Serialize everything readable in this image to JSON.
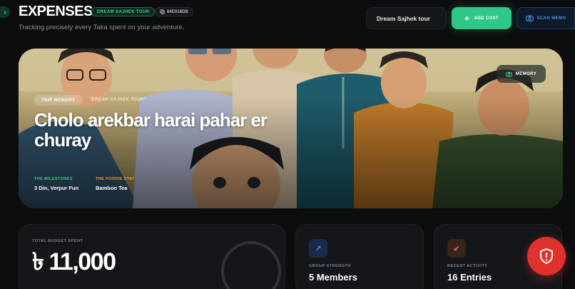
{
  "header": {
    "title": "EXPENSES",
    "trip_badge": "DREAM SAJHEK TOUR",
    "trip_id": "84D018DB",
    "subtitle": "Tracking precisely every Taka spent on your adventure."
  },
  "toolbar": {
    "trip_select_value": "Dream Sajhek tour",
    "add_cost_label": "ADD COST",
    "scan_memo_label": "SCAN MEMO"
  },
  "hero": {
    "badge": "TRIP MEMORY",
    "quote": "\"DREAM SAJHEK TOUR\"",
    "title": "Cholo arekbar harai pahar er churay",
    "memory_button": "MEMORY",
    "milestones_label": "THE MILESTONES",
    "milestones_value": "3 Din, Verpur Fun",
    "foodie_label": "THE FOODIE STAT",
    "foodie_value": "Bamboo Tea"
  },
  "cards": {
    "budget_label": "TOTAL BUDGET SPENT",
    "budget_value": "৳ 11,000",
    "group_label": "GROUP STRENGTH",
    "group_value": "5 Members",
    "activity_label": "RECENT ACTIVITY",
    "activity_value": "16 Entries"
  },
  "icons": {
    "sidebar_toggle": "chevron-right-icon",
    "id_badge": "copy-icon",
    "add_cost": "plus-icon",
    "scan_memo": "camera-icon",
    "memory": "camera-icon",
    "group": "arrow-up-right-icon",
    "activity": "arrow-down-left-icon",
    "fab": "shield-alert-icon"
  },
  "colors": {
    "accent_green": "#2ec787",
    "accent_blue": "#4f8fe8",
    "milestone_label": "#35d17f",
    "foodie_label": "#f0a030",
    "group_icon": "#4f8fe8",
    "activity_icon": "#e8834f",
    "fab": "#e0312d"
  }
}
